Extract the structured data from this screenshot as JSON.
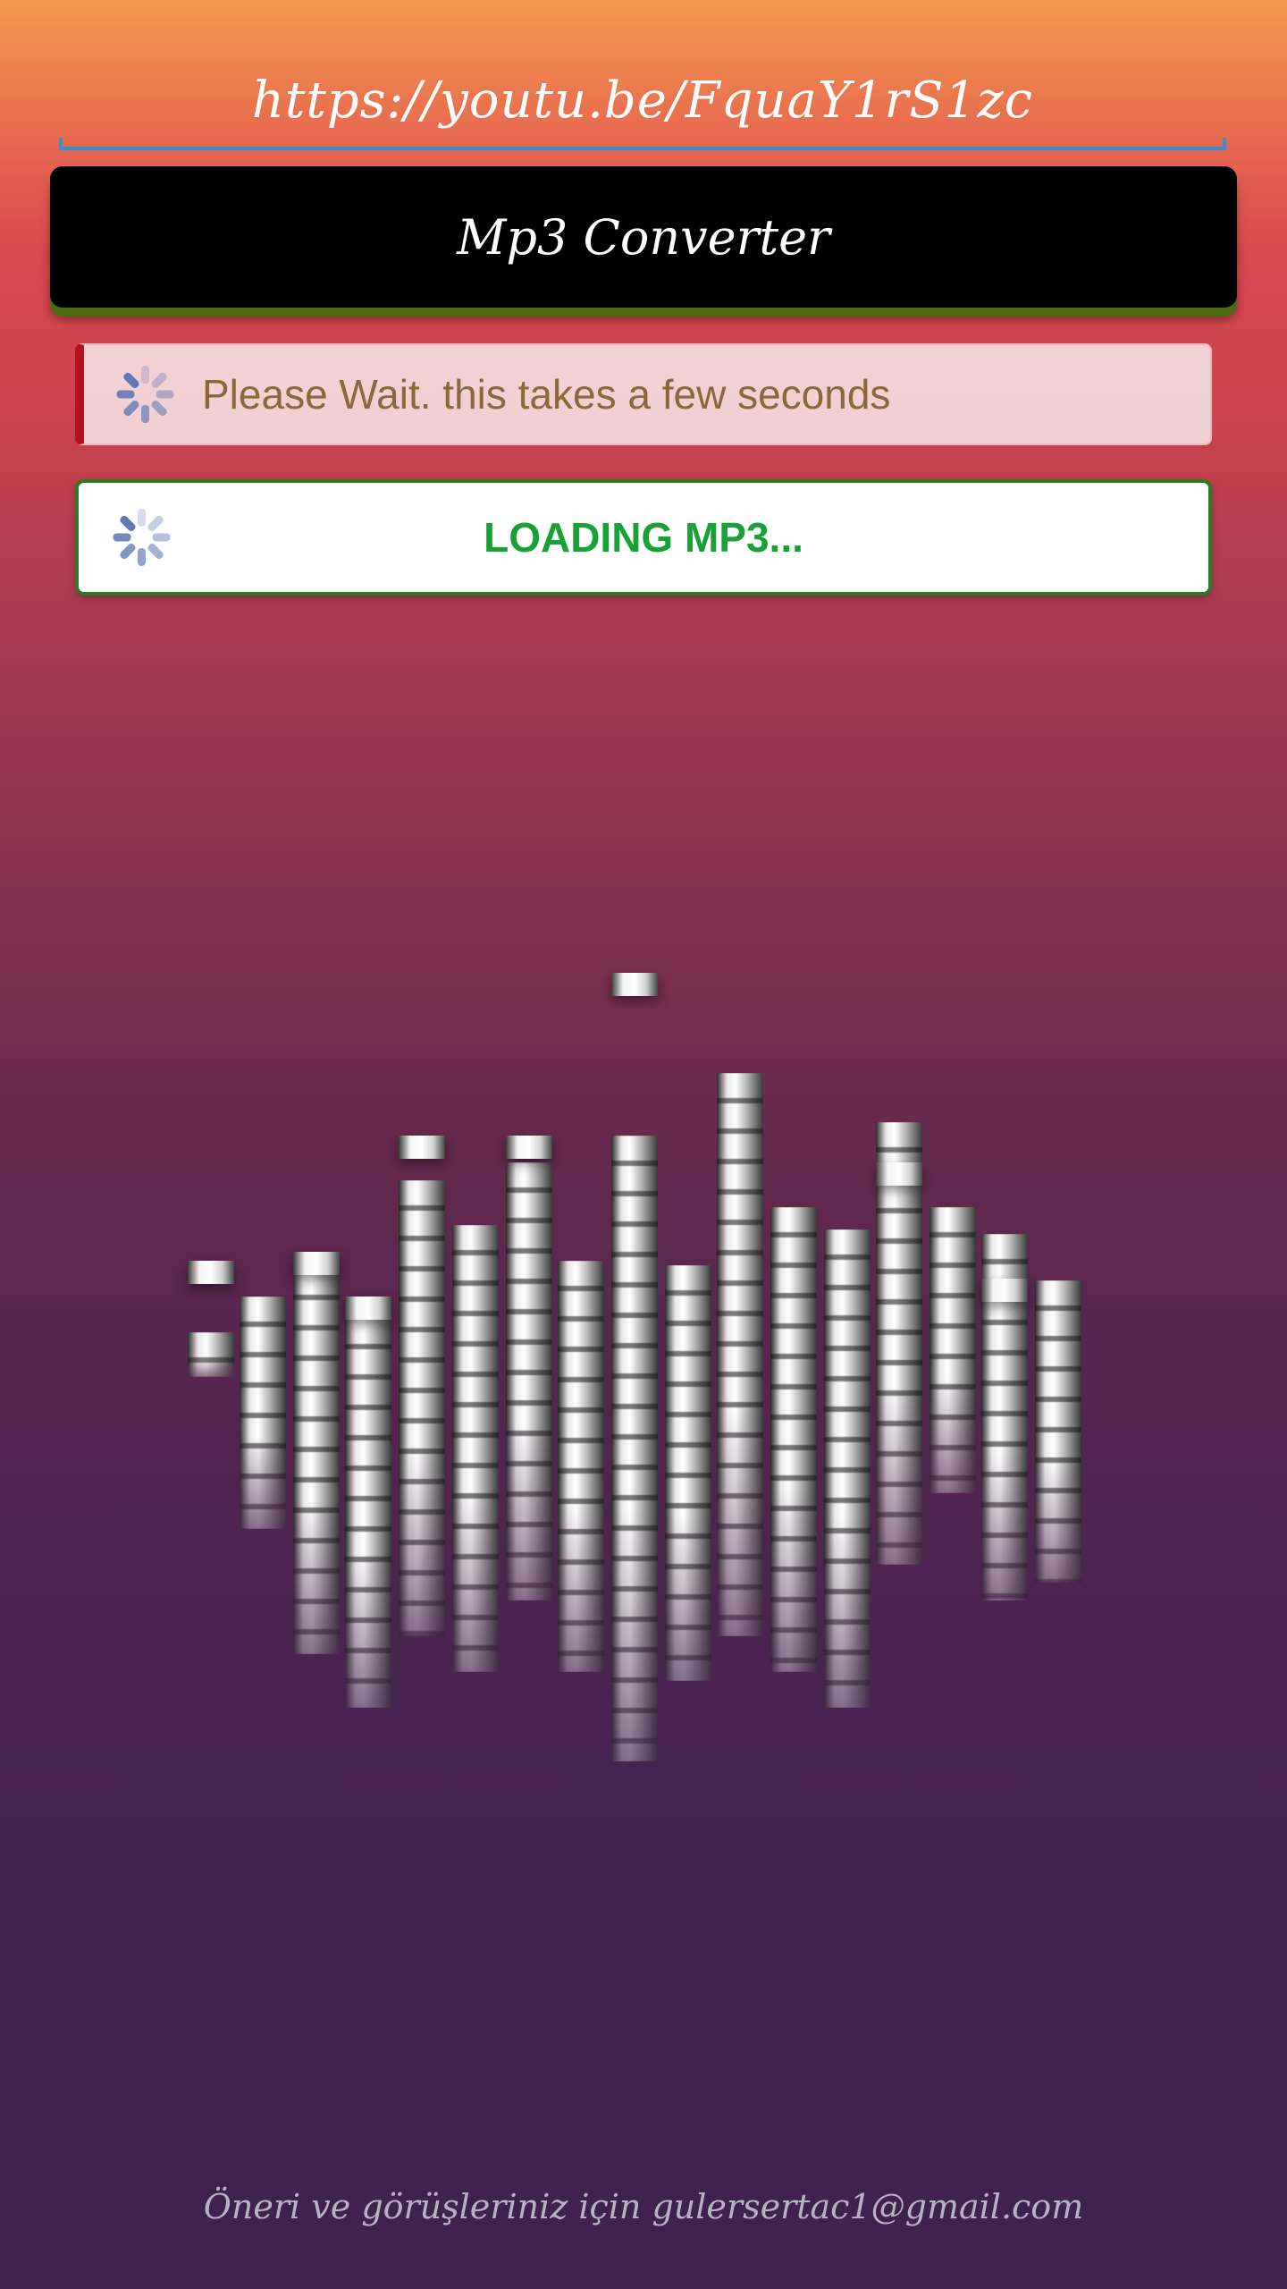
{
  "url_input": {
    "value": "https://youtu.be/FquaY1rS1zc"
  },
  "convert_button": {
    "label": "Mp3 Converter"
  },
  "info_message": {
    "text": "Please Wait. this takes a few seconds",
    "icon": "spinner-icon"
  },
  "loading_button": {
    "label": "LOADING MP3...",
    "icon": "spinner-icon"
  },
  "illustration": {
    "icon": "equalizer-icon"
  },
  "footer": {
    "text": "Öneri ve görüşleriniz için gulersertac1@gmail.com"
  },
  "colors": {
    "accent_blue": "#3f8bc9",
    "button_black": "#000000",
    "info_border_red": "#b5121b",
    "info_text": "#8a6838",
    "loading_green": "#18a235",
    "loading_border": "#2c7a25"
  }
}
